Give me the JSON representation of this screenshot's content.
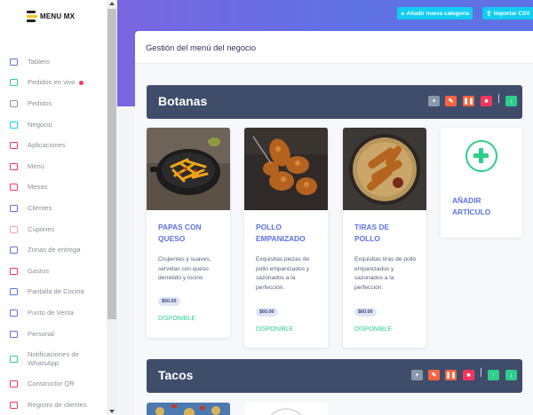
{
  "brand": {
    "name": "MENU MX"
  },
  "sidebar": {
    "items": [
      {
        "label": "Tablero",
        "icon": "monitor-icon",
        "color": "#5e72e4"
      },
      {
        "label": "Pedidos en vivo",
        "icon": "basket-icon",
        "color": "#2dce89",
        "live": true
      },
      {
        "label": "Pedidos",
        "icon": "box-icon",
        "color": "#8898aa"
      },
      {
        "label": "Negocio",
        "icon": "store-icon",
        "color": "#11cdef"
      },
      {
        "label": "Aplicaciones",
        "icon": "apps-icon",
        "color": "#f5365c"
      },
      {
        "label": "Menú",
        "icon": "menu-book-icon",
        "color": "#f5365c"
      },
      {
        "label": "Mesas",
        "icon": "table-icon",
        "color": "#f5365c"
      },
      {
        "label": "Clientes",
        "icon": "user-icon",
        "color": "#5e72e4"
      },
      {
        "label": "Cupones",
        "icon": "tag-icon",
        "color": "#f3a4b5"
      },
      {
        "label": "Zonas de entrega",
        "icon": "map-pin-icon",
        "color": "#5e72e4"
      },
      {
        "label": "Gastos",
        "icon": "receipt-icon",
        "color": "#f5365c"
      },
      {
        "label": "Pantalla de Cocina",
        "icon": "screen-icon",
        "color": "#5e72e4"
      },
      {
        "label": "Punto de Venta",
        "icon": "pos-icon",
        "color": "#5e72e4"
      },
      {
        "label": "Personal",
        "icon": "staff-icon",
        "color": "#5e72e4"
      },
      {
        "label": "Notificaciones de WhatsApp",
        "icon": "whatsapp-icon",
        "color": "#2dce89"
      },
      {
        "label": "Constructor QR",
        "icon": "qr-icon",
        "color": "#f5365c"
      },
      {
        "label": "Registro de clientes",
        "icon": "register-icon",
        "color": "#f5365c"
      }
    ]
  },
  "header": {
    "add_category": "Añadir nueva categoría",
    "import_csv": "Importar CSV"
  },
  "main": {
    "title": "Gestión del menú del negocio"
  },
  "categories": [
    {
      "name": "Botanas",
      "items": [
        {
          "name": "PAPAS CON QUESO",
          "description": "Crujientes y suaves, servidas con queso derretido y tocino",
          "price": "$50.00",
          "status": "DISPONIBLE"
        },
        {
          "name": "POLLO EMPANIZADO",
          "description": "Exquisitas piezas de pollo empanizados y sazonados a la perfección.",
          "price": "$60.00",
          "status": "DISPONIBLE"
        },
        {
          "name": "TIRAS DE POLLO",
          "description": "Exquisitas tiras de pollo empanizados y sazonados a la perfección.",
          "price": "$60.00",
          "status": "DISPONIBLE"
        }
      ],
      "add_item": "AÑADIR ARTÍCULO"
    },
    {
      "name": "Tacos"
    }
  ],
  "colors": {
    "primary": "#5e72e4",
    "success": "#2dce89",
    "info": "#11cdef",
    "danger": "#f5365c",
    "warning": "#fb6340",
    "category_bar": "#3f4d6b"
  }
}
